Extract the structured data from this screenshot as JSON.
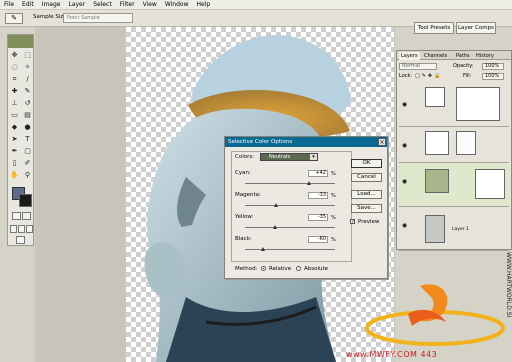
{
  "menu": [
    "File",
    "Edit",
    "Image",
    "Layer",
    "Select",
    "Filter",
    "View",
    "Window",
    "Help"
  ],
  "options_bar": {
    "label": "Sample Size:",
    "value": "Point Sample",
    "tab_tool_presets": "Tool Presets",
    "tab_layer_comps": "Layer Comps"
  },
  "dialog": {
    "title": "Selective Color Options",
    "colors_label": "Colors:",
    "colors_value": "Neutrals",
    "sliders": [
      {
        "label": "Cyan:",
        "value": "+42",
        "unit": "%",
        "level": 0.71
      },
      {
        "label": "Magenta:",
        "value": "-33",
        "unit": "%",
        "level": 0.34
      },
      {
        "label": "Yellow:",
        "value": "-35",
        "unit": "%",
        "level": 0.33
      },
      {
        "label": "Black:",
        "value": "-60",
        "unit": "%",
        "level": 0.2
      }
    ],
    "buttons": {
      "ok": "OK",
      "cancel": "Cancel",
      "load": "Load...",
      "save": "Save..."
    },
    "preview_label": "Preview",
    "method_label": "Method:",
    "relative_label": "Relative",
    "absolute_label": "Absolute"
  },
  "layers_panel": {
    "tabs": [
      "Layers",
      "Channels",
      "Paths",
      "History"
    ],
    "blend_mode": "Normal",
    "opacity_label": "Opacity:",
    "opacity_value": "100%",
    "lock_label": "Lock:",
    "fill_label": "Fill:",
    "fill_value": "100%",
    "layer_name": "Layer 1"
  },
  "watermark": "WWW.HARTWORLD.SI",
  "bottom_text": "www.MWFY.COM 443"
}
